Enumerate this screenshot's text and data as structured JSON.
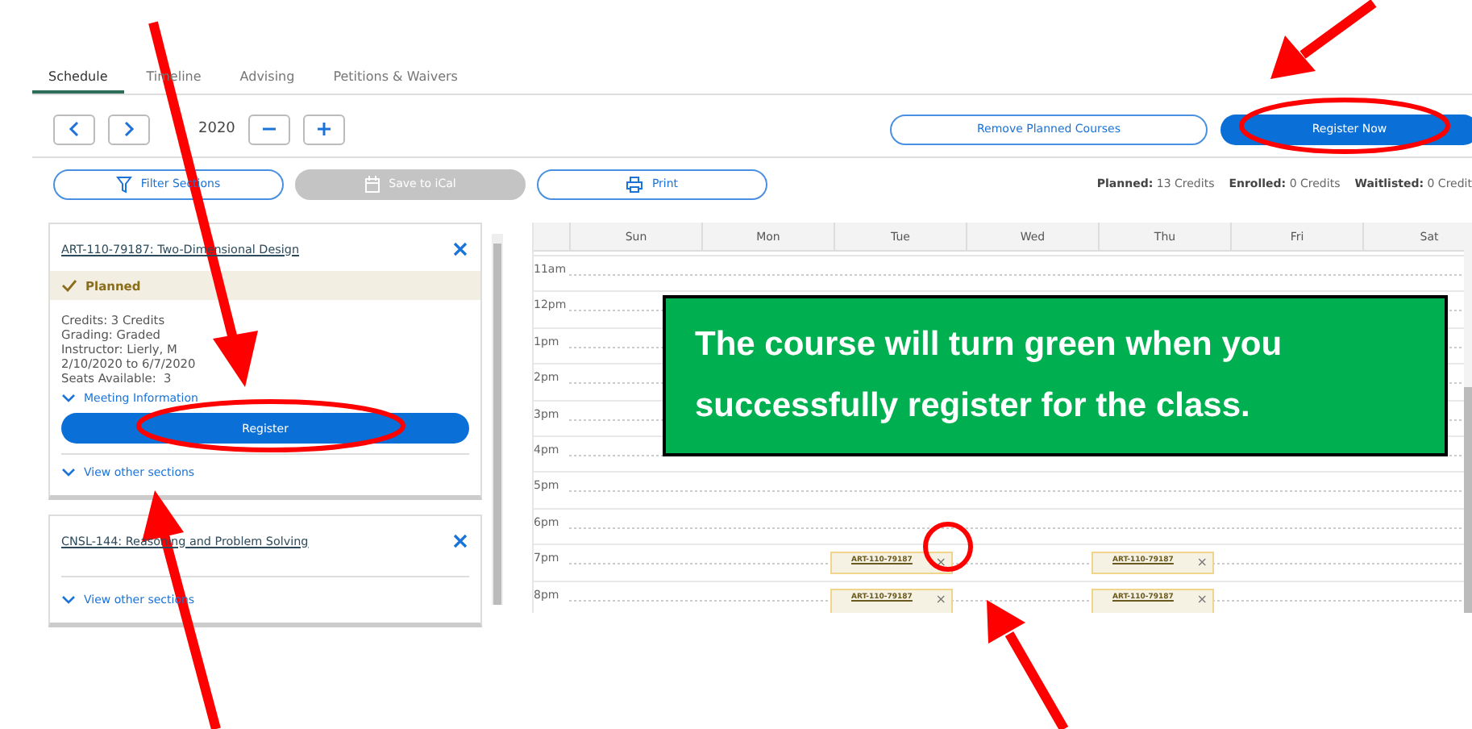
{
  "tabs": [
    {
      "label": "Schedule",
      "selected": true
    },
    {
      "label": "Timeline",
      "selected": false
    },
    {
      "label": "Advising",
      "selected": false
    },
    {
      "label": "Petitions & Waivers",
      "selected": false
    }
  ],
  "term": {
    "year": "2020"
  },
  "actions": {
    "remove": "Remove Planned Courses",
    "register": "Register Now"
  },
  "tools": [
    {
      "kind": "filter",
      "label": "Filter Sections",
      "disabled": false
    },
    {
      "kind": "calendar",
      "label": "Save to iCal",
      "disabled": true
    },
    {
      "kind": "print",
      "label": "Print",
      "disabled": false
    }
  ],
  "credits": [
    {
      "label": "Planned:",
      "value": "13 Credits"
    },
    {
      "label": "Enrolled:",
      "value": "0 Credits"
    },
    {
      "label": "Waitlisted:",
      "value": "0 Credit"
    }
  ],
  "courses": [
    {
      "title": "ART-110-79187: Two-Dimensional Design",
      "status": "Planned",
      "details": [
        "Credits: 3 Credits",
        "Grading: Graded",
        "Instructor: Lierly, M",
        "2/10/2020 to 6/7/2020",
        "Seats Available:  3"
      ],
      "meeting": "Meeting Information",
      "register": "Register",
      "other_sections": "View other sections"
    },
    {
      "title": "CNSL-144: Reasoning and Problem Solving",
      "other_sections": "View other sections"
    }
  ],
  "calendar": {
    "days": [
      "Sun",
      "Mon",
      "Tue",
      "Wed",
      "Thu",
      "Fri",
      "Sat"
    ],
    "rows": [
      {
        "time": "11am"
      },
      {
        "time": "12pm"
      },
      {
        "time": "1pm"
      },
      {
        "time": "2pm"
      },
      {
        "time": "3pm"
      },
      {
        "time": "4pm"
      },
      {
        "time": "5pm"
      },
      {
        "time": "6pm"
      },
      {
        "time": "7pm",
        "cells": [
          null,
          null,
          {
            "title": "ART-110-79187",
            "close": "×"
          },
          null,
          {
            "title": "ART-110-79187",
            "close": "×"
          },
          null,
          null
        ]
      },
      {
        "time": "8pm",
        "cells": [
          null,
          null,
          {
            "title": "ART-110-79187",
            "close": "×"
          },
          null,
          {
            "title": "ART-110-79187",
            "close": "×"
          },
          null,
          null
        ]
      }
    ]
  },
  "callout": {
    "text": "The course will turn green when you successfully register for the class."
  }
}
